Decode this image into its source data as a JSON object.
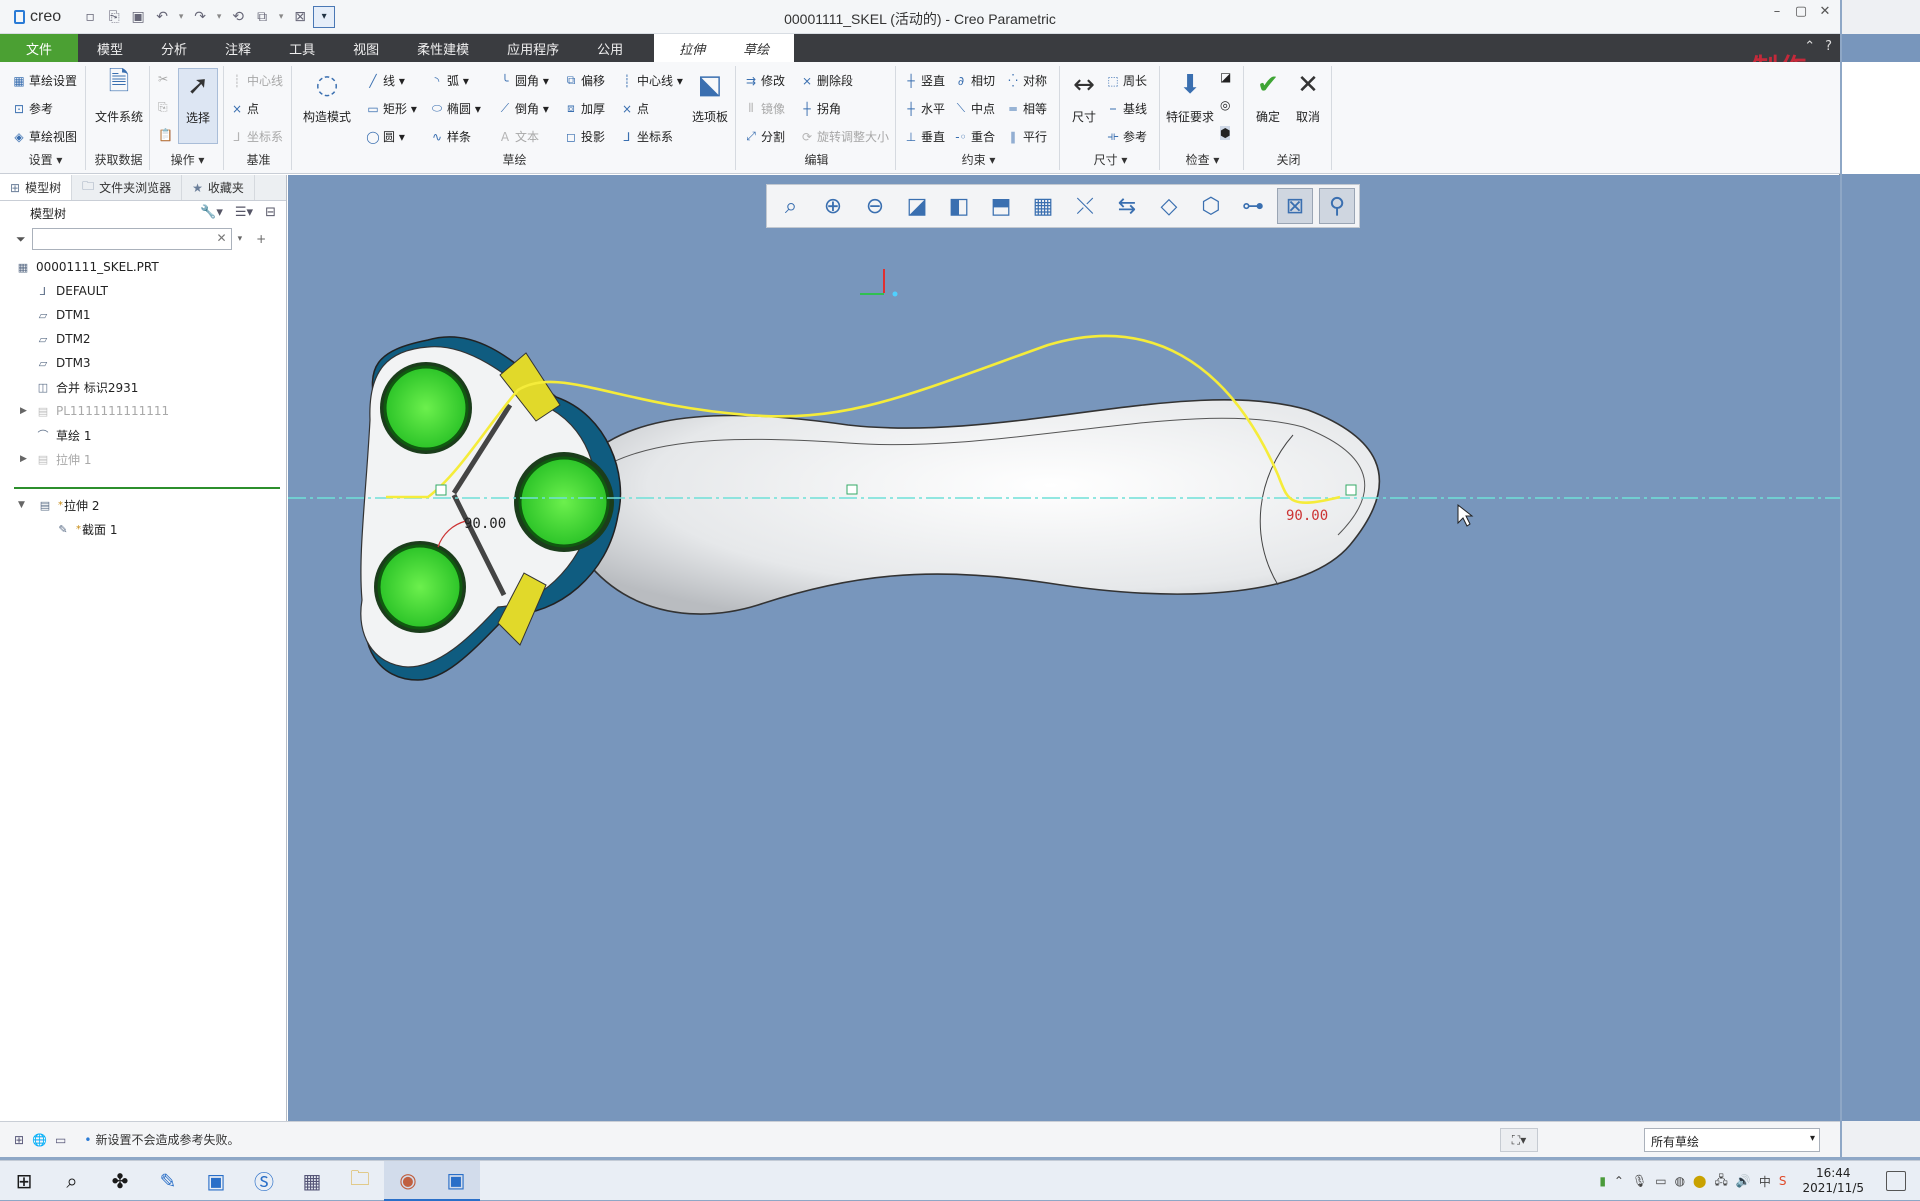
{
  "app": {
    "logo_text": "creo",
    "window_title": "00001111_SKEL (活动的) - Creo Parametric",
    "watermark": "制作"
  },
  "menu": {
    "file": "文件",
    "tabs": [
      "模型",
      "分析",
      "注释",
      "工具",
      "视图",
      "柔性建模",
      "应用程序",
      "公用"
    ],
    "context_tabs": [
      "拉伸",
      "草绘"
    ]
  },
  "ribbon": {
    "setup": {
      "title": "设置",
      "items": [
        "草绘设置",
        "参考",
        "草绘视图"
      ]
    },
    "get_data": {
      "title": "获取数据",
      "file_system": "文件系统"
    },
    "operations": {
      "title": "操作",
      "select": "选择"
    },
    "datum": {
      "title": "基准",
      "items": [
        "中心线",
        "点",
        "坐标系"
      ]
    },
    "sketch": {
      "title": "草绘",
      "construction": "构造模式",
      "col1": [
        "线",
        "矩形",
        "圆"
      ],
      "col2": [
        "弧",
        "椭圆",
        "样条"
      ],
      "col3": [
        "圆角",
        "倒角",
        "文本"
      ],
      "col4": [
        "偏移",
        "加厚",
        "投影"
      ],
      "col5": [
        "中心线",
        "点",
        "坐标系"
      ],
      "palette": "选项板"
    },
    "edit": {
      "title": "编辑",
      "items": [
        "修改",
        "删除段",
        "镜像",
        "拐角",
        "分割",
        "旋转调整大小"
      ]
    },
    "constrain": {
      "title": "约束",
      "items": [
        "竖直",
        "相切",
        "对称",
        "水平",
        "中点",
        "相等",
        "垂直",
        "重合",
        "平行"
      ]
    },
    "dimension": {
      "title": "尺寸",
      "main": "尺寸",
      "items": [
        "周长",
        "基线",
        "参考"
      ]
    },
    "inspect": {
      "title": "检查",
      "main": "特征要求"
    },
    "close": {
      "title": "关闭",
      "ok": "确定",
      "cancel": "取消"
    }
  },
  "panel": {
    "tabs": [
      "模型树",
      "文件夹浏览器",
      "收藏夹"
    ],
    "tree_header": "模型树",
    "tree": [
      {
        "label": "00001111_SKEL.PRT",
        "icon": "part-icon",
        "level": 0,
        "dim": false
      },
      {
        "label": "DEFAULT",
        "icon": "csys-icon",
        "level": 1,
        "dim": false
      },
      {
        "label": "DTM1",
        "icon": "plane-icon",
        "level": 1,
        "dim": false
      },
      {
        "label": "DTM2",
        "icon": "plane-icon",
        "level": 1,
        "dim": false
      },
      {
        "label": "DTM3",
        "icon": "plane-icon",
        "level": 1,
        "dim": false
      },
      {
        "label": "合并 标识2931",
        "icon": "merge-icon",
        "level": 1,
        "dim": false
      },
      {
        "label": "PL1111111111111",
        "icon": "feature-icon",
        "level": 1,
        "dim": true
      },
      {
        "label": "草绘 1",
        "icon": "sketch-icon",
        "level": 1,
        "dim": false
      },
      {
        "label": "拉伸 1",
        "icon": "extrude-icon",
        "level": 1,
        "dim": true
      }
    ],
    "active_feature": "拉伸 2",
    "active_child": "截面 1"
  },
  "viewport": {
    "dim_left": "90.00",
    "dim_right": "90.00"
  },
  "status": {
    "message": "新设置不会造成参考失败。",
    "filter": "所有草绘"
  },
  "taskbar": {
    "time": "16:44",
    "date": "2021/11/5"
  }
}
